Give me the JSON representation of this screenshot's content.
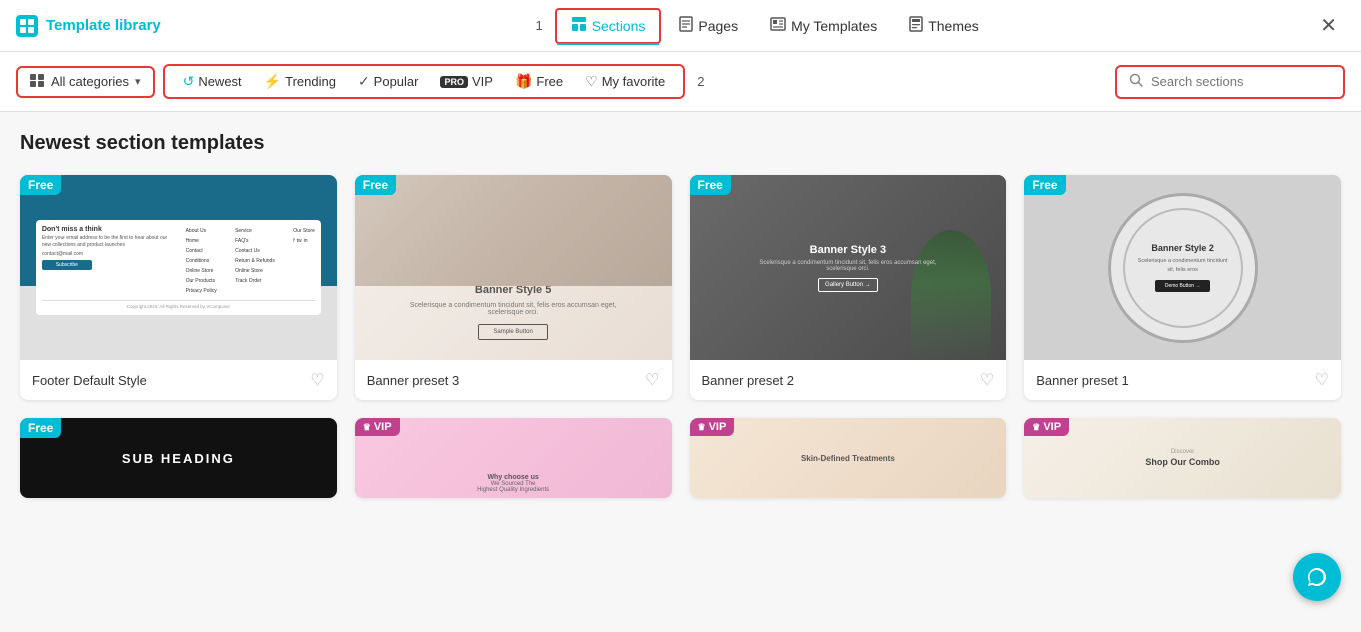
{
  "app": {
    "title": "Template library",
    "logo_icon": "T"
  },
  "nav": {
    "step_number": "1",
    "filter_number": "2",
    "items": [
      {
        "id": "sections",
        "label": "Sections",
        "active": true
      },
      {
        "id": "pages",
        "label": "Pages",
        "active": false
      },
      {
        "id": "my-templates",
        "label": "My Templates",
        "active": false
      },
      {
        "id": "themes",
        "label": "Themes",
        "active": false
      }
    ]
  },
  "filters": {
    "category_label": "All categories",
    "tabs": [
      {
        "id": "newest",
        "label": "Newest",
        "icon": "🔄"
      },
      {
        "id": "trending",
        "label": "Trending",
        "icon": "⚡"
      },
      {
        "id": "popular",
        "label": "Popular",
        "icon": "✓"
      },
      {
        "id": "vip",
        "label": "VIP",
        "icon": "PRO"
      },
      {
        "id": "free",
        "label": "Free",
        "icon": "🎁"
      },
      {
        "id": "my-favorite",
        "label": "My favorite",
        "icon": "♡"
      }
    ]
  },
  "search": {
    "placeholder": "Search sections"
  },
  "content": {
    "section_title": "Newest section templates",
    "row1": [
      {
        "name": "Footer Default Style",
        "badge": "Free",
        "badge_type": "free"
      },
      {
        "name": "Banner preset 3",
        "badge": "Free",
        "badge_type": "free"
      },
      {
        "name": "Banner preset 2",
        "badge": "Free",
        "badge_type": "free"
      },
      {
        "name": "Banner preset 1",
        "badge": "Free",
        "badge_type": "free"
      }
    ],
    "row2": [
      {
        "name": "",
        "badge": "Free",
        "badge_type": "free"
      },
      {
        "name": "",
        "badge": "VIP",
        "badge_type": "vip"
      },
      {
        "name": "",
        "badge": "VIP",
        "badge_type": "vip"
      },
      {
        "name": "",
        "badge": "VIP",
        "badge_type": "vip"
      }
    ]
  }
}
